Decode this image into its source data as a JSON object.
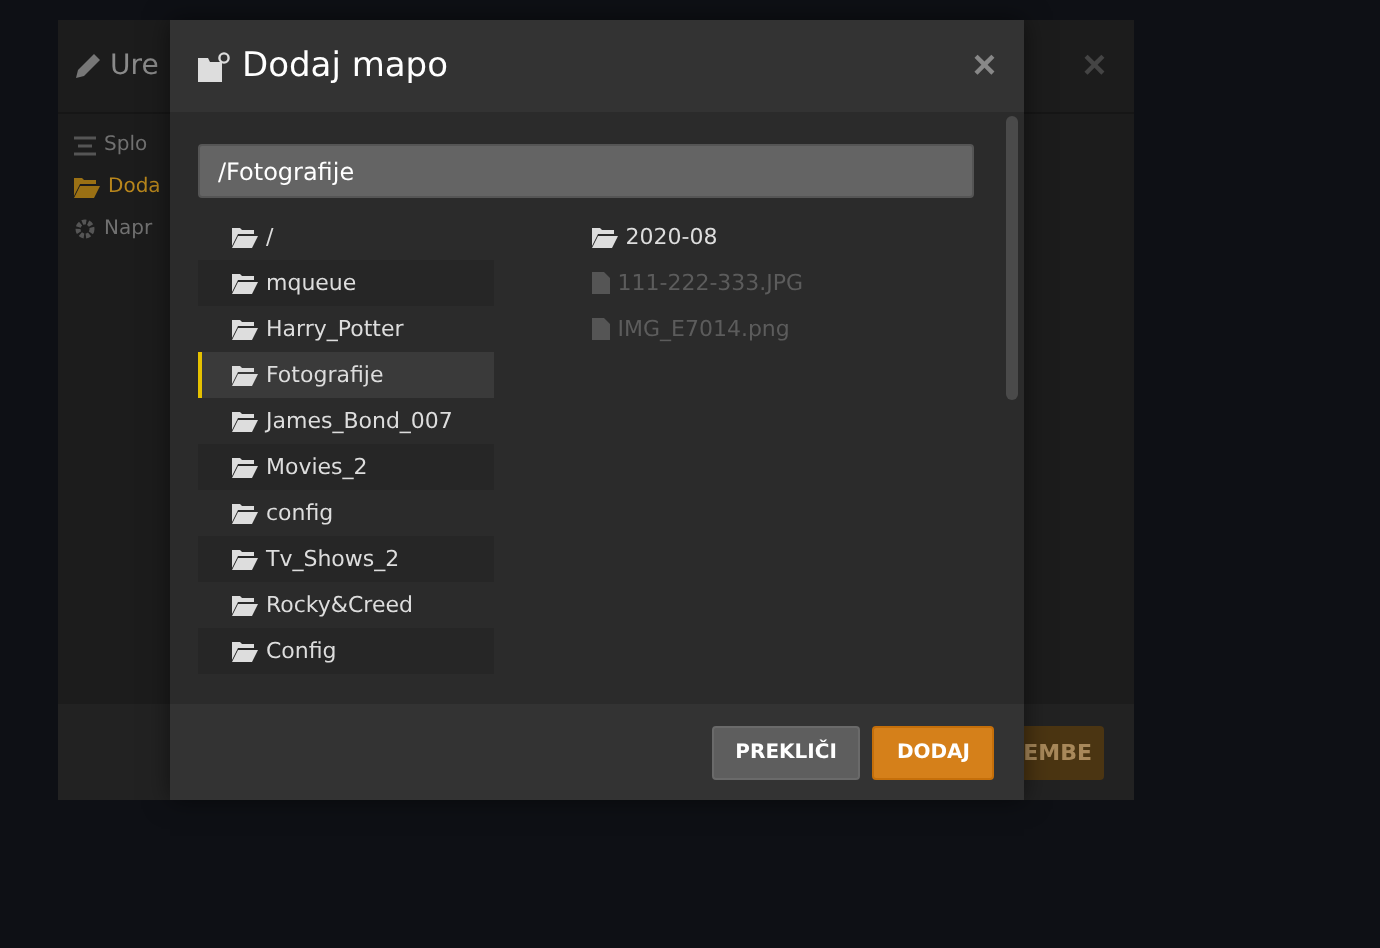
{
  "background_dialog": {
    "title": "Ure",
    "close": "×",
    "sidebar": [
      {
        "kind": "list",
        "label": "Splo",
        "selected": false
      },
      {
        "kind": "folder",
        "label": "Doda",
        "selected": true
      },
      {
        "kind": "gear",
        "label": "Napr",
        "selected": false
      }
    ],
    "footer_button": "EMBE"
  },
  "dialog": {
    "title": "Dodaj mapo",
    "close": "×",
    "path": "/Fotografije",
    "folders": [
      {
        "label": "/",
        "selected": false
      },
      {
        "label": "mqueue",
        "selected": false
      },
      {
        "label": "Harry_Potter",
        "selected": false
      },
      {
        "label": "Fotografije",
        "selected": true
      },
      {
        "label": "James_Bond_007",
        "selected": false
      },
      {
        "label": "Movies_2",
        "selected": false
      },
      {
        "label": "config",
        "selected": false
      },
      {
        "label": "Tv_Shows_2",
        "selected": false
      },
      {
        "label": "Rocky&Creed",
        "selected": false
      },
      {
        "label": "Config",
        "selected": false
      }
    ],
    "contents": [
      {
        "kind": "folder",
        "label": "2020-08"
      },
      {
        "kind": "file",
        "label": "111-222-333.JPG"
      },
      {
        "kind": "file",
        "label": "IMG_E7014.png"
      }
    ],
    "buttons": [
      {
        "kind": "secondary",
        "label": "PREKLIČI"
      },
      {
        "kind": "primary",
        "label": "DODAJ"
      }
    ]
  }
}
